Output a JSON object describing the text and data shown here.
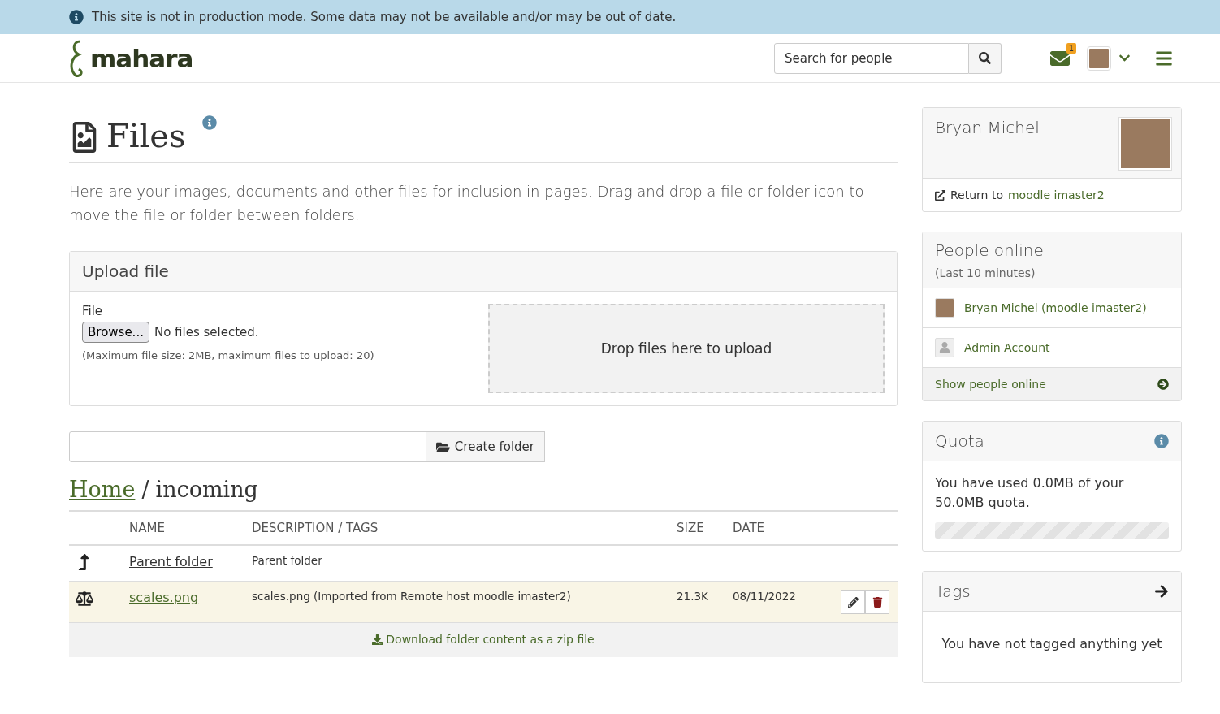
{
  "banner": {
    "text": "This site is not in production mode. Some data may not be available and/or may be out of date."
  },
  "header": {
    "logo": "mahara",
    "search": {
      "placeholder": "Search for people"
    },
    "mail_count": "1"
  },
  "page": {
    "title": "Files",
    "intro": "Here are your images, documents and other files for inclusion in pages. Drag and drop a file or folder icon to move the file or folder between folders."
  },
  "upload": {
    "heading": "Upload file",
    "label": "File",
    "browse": "Browse...",
    "status": "No files selected.",
    "hint": "(Maximum file size: 2MB, maximum files to upload: 20)",
    "dropzone": "Drop files here to upload"
  },
  "create_folder": {
    "button": "Create folder"
  },
  "breadcrumb": {
    "home": "Home",
    "separator": "/",
    "current": "incoming"
  },
  "table": {
    "columns": [
      "NAME",
      "DESCRIPTION / TAGS",
      "SIZE",
      "DATE"
    ],
    "rows": [
      {
        "kind": "parent",
        "name": "Parent folder",
        "description": "Parent folder",
        "highlighted": false
      },
      {
        "kind": "file",
        "name": "scales.png",
        "description": "scales.png (Imported from Remote host moodle imaster2)",
        "size": "21.3K",
        "date": "08/11/2022",
        "highlighted": true
      }
    ],
    "download": "Download folder content as a zip file"
  },
  "sidebar": {
    "profile": {
      "name": "Bryan Michel",
      "return_prefix": "Return to",
      "return_link": "moodle imaster2"
    },
    "online": {
      "title": "People online",
      "subtitle": "(Last 10 minutes)",
      "people": [
        {
          "kind": "photo",
          "name": "Bryan Michel (moodle imaster2)"
        },
        {
          "kind": "default",
          "name": "Admin Account"
        }
      ],
      "footer": "Show people online"
    },
    "quota": {
      "title": "Quota",
      "text": "You have used 0.0MB of your 50.0MB quota.",
      "level": 0
    },
    "tags": {
      "title": "Tags",
      "empty": "You have not tagged anything yet"
    }
  }
}
